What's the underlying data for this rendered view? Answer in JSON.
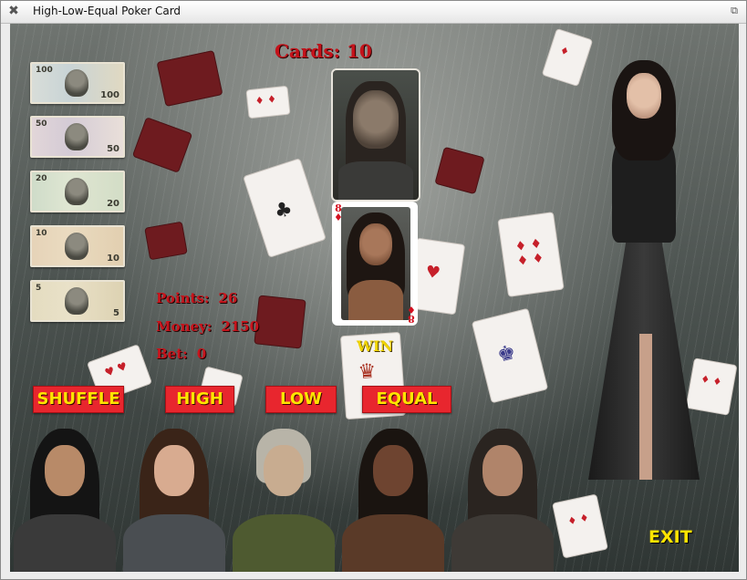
{
  "window": {
    "title": "High-Low-Equal Poker Card"
  },
  "game": {
    "cards_label": "Cards:",
    "cards_count": "10",
    "points_label": "Points:",
    "points_value": "26",
    "money_label": "Money:",
    "money_value": "2150",
    "bet_label": "Bet:",
    "bet_value": "0",
    "result": "WIN"
  },
  "player_card": {
    "rank": "8",
    "suit": "♦"
  },
  "money_notes": [
    "100",
    "50",
    "20",
    "10",
    "5"
  ],
  "buttons": {
    "shuffle": "SHUFFLE",
    "high": "HIGH",
    "low": "LOW",
    "equal": "EQUAL",
    "exit": "EXIT"
  },
  "colors": {
    "button_bg": "#e8262e",
    "button_text": "#ffe400",
    "stat_text": "#c8141c",
    "result_text": "#f0d400"
  }
}
